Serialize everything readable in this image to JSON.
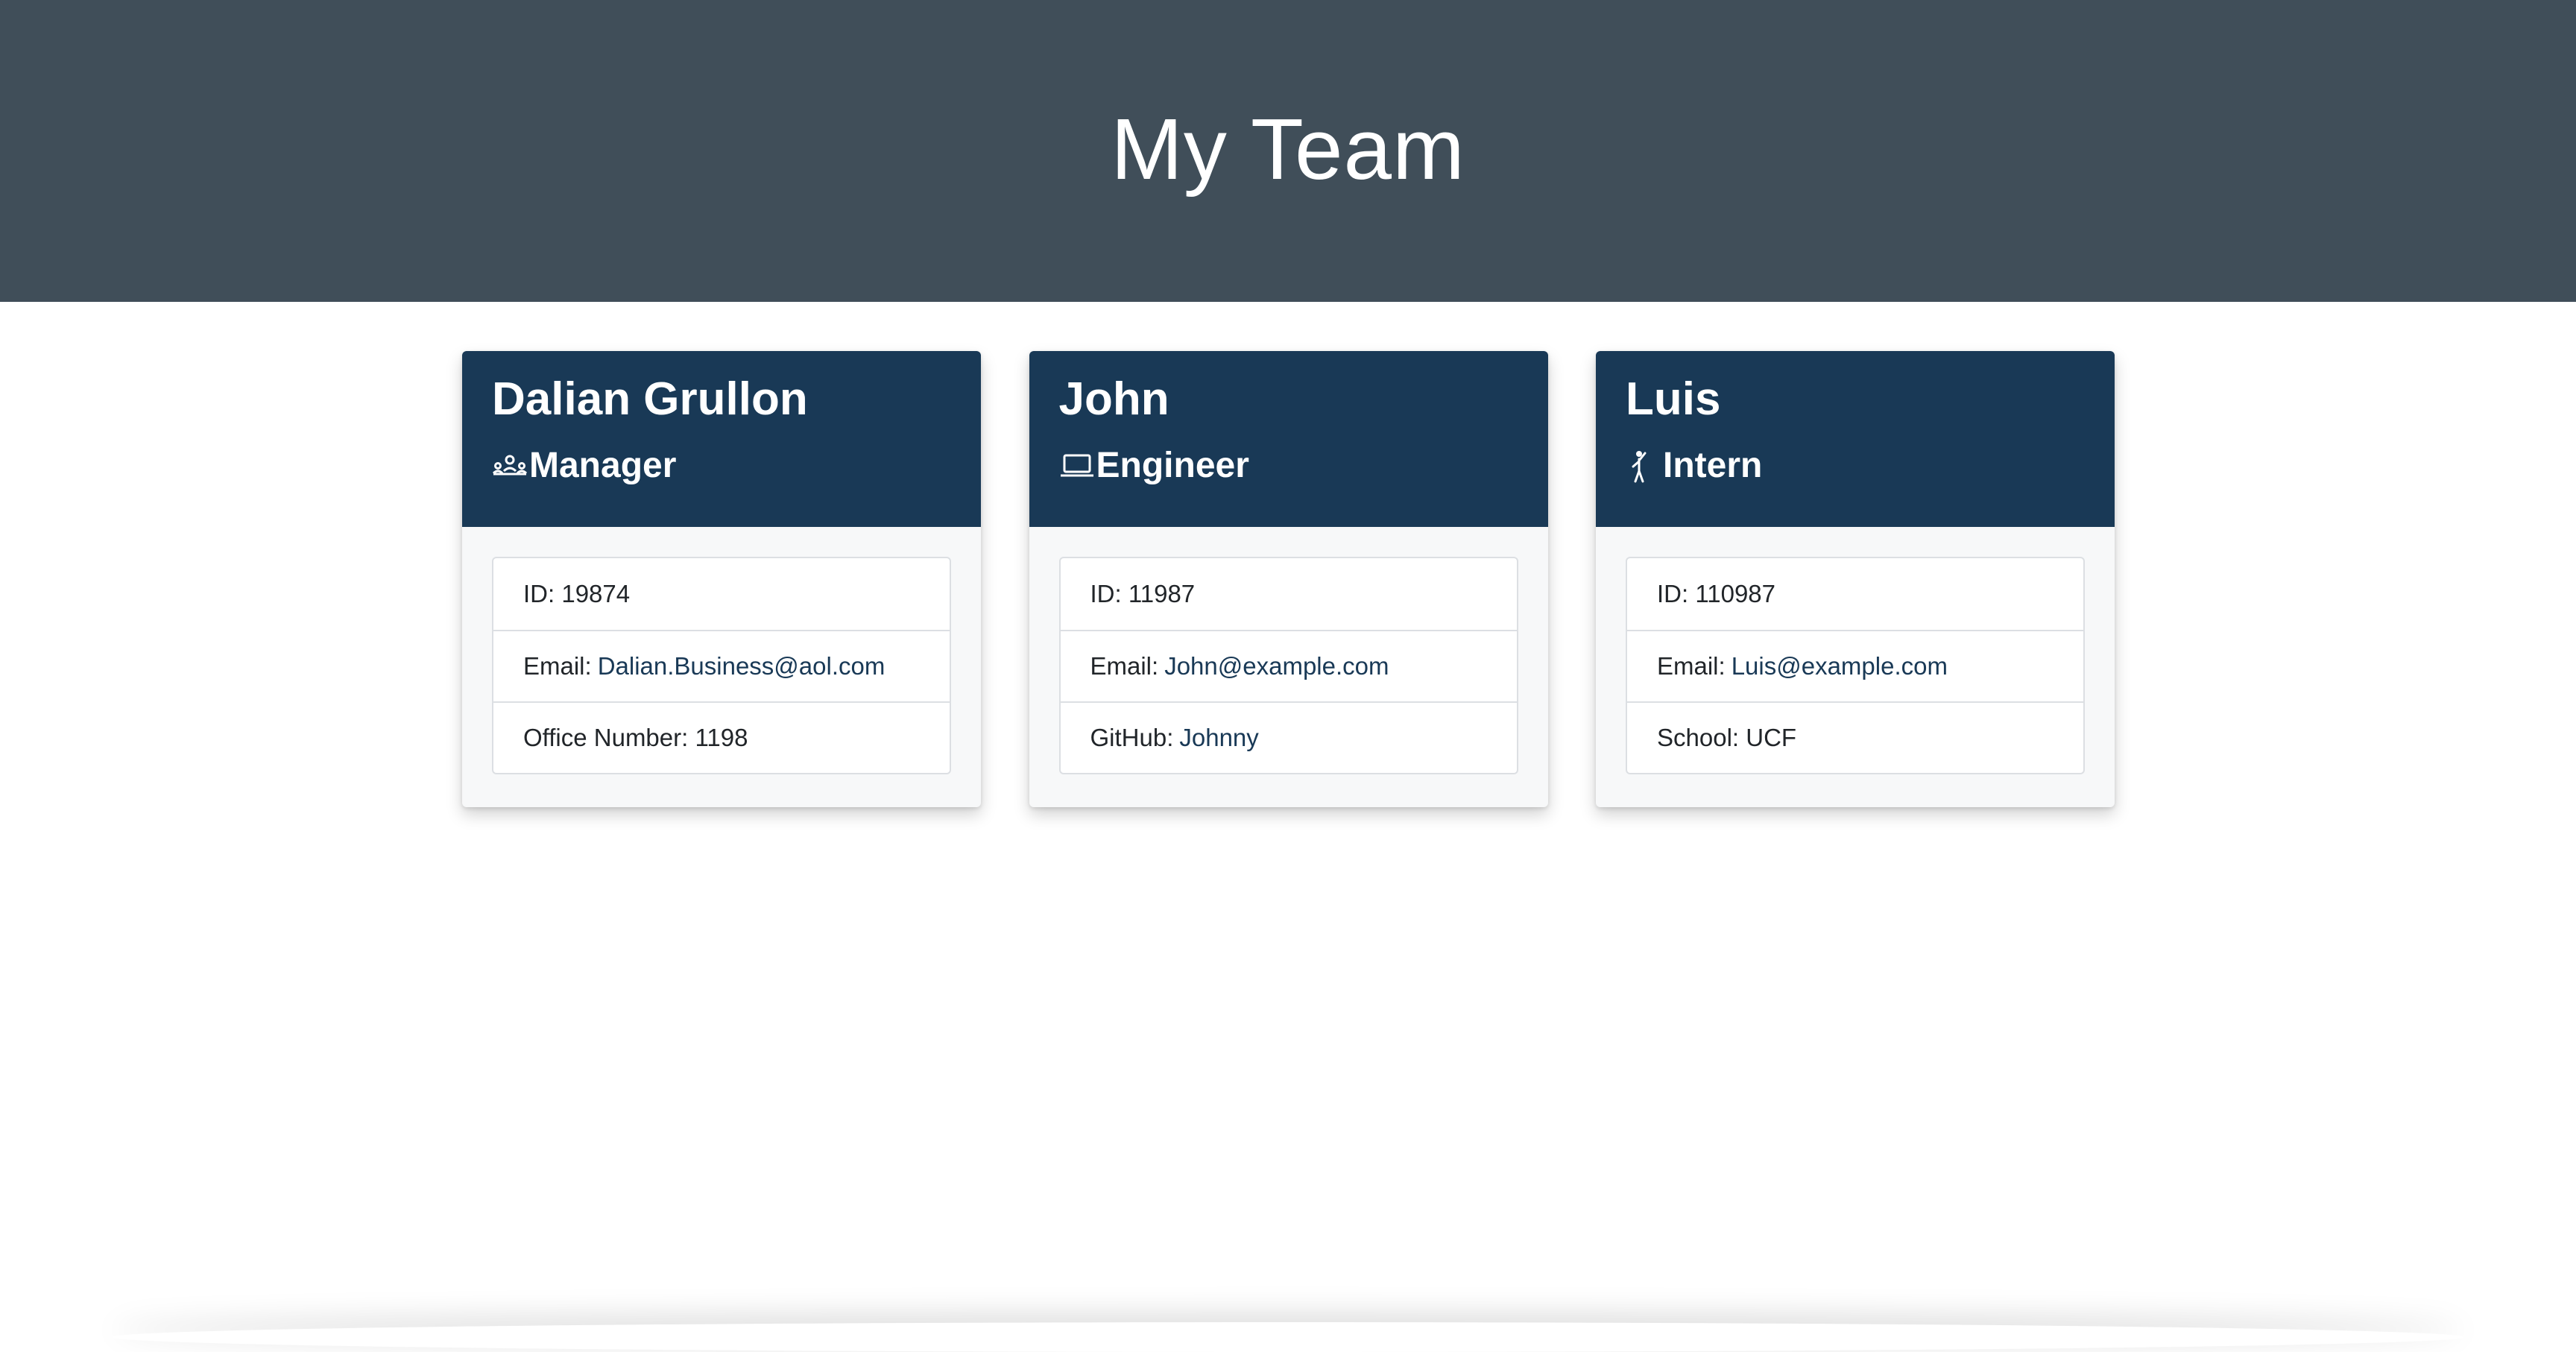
{
  "header": {
    "title": "My Team"
  },
  "cards": [
    {
      "name": "Dalian Grullon",
      "role": "Manager",
      "icon": "people-icon",
      "id_label": "ID: 19874",
      "email_label": "Email:",
      "email": "Dalian.Business@aol.com",
      "extra_label": "Office Number: 1198"
    },
    {
      "name": "John",
      "role": "Engineer",
      "icon": "laptop-icon",
      "id_label": "ID: 11987",
      "email_label": "Email:",
      "email": "John@example.com",
      "extra_label": "GitHub:",
      "extra_link": "Johnny"
    },
    {
      "name": "Luis",
      "role": "Intern",
      "icon": "person-raising-hand-icon",
      "id_label": "ID: 110987",
      "email_label": "Email:",
      "email": "Luis@example.com",
      "extra_label": "School: UCF"
    }
  ],
  "colors": {
    "header_bg": "#404e59",
    "card_header_bg": "#193956",
    "link": "#193956"
  }
}
